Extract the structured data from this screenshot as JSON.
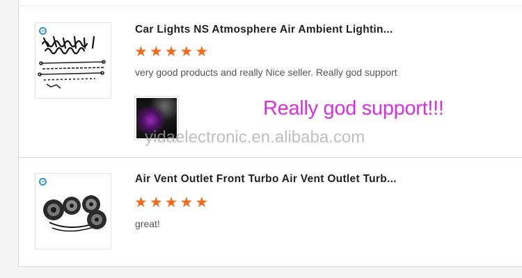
{
  "reviews": [
    {
      "title": "Car Lights NS Atmosphere Air Ambient Lightin...",
      "rating": 5,
      "stars": [
        "★",
        "★",
        "★",
        "★",
        "★"
      ],
      "comment": "very good products and really Nice seller. Really god support",
      "product_image_icon": "led-strip-kit-image",
      "photo_icon": "car-interior-ambient-light-photo"
    },
    {
      "title": "Air Vent Outlet Front Turbo Air Vent Outlet Turb...",
      "rating": 5,
      "stars": [
        "★",
        "★",
        "★",
        "★",
        "★"
      ],
      "comment": "great!",
      "product_image_icon": "turbo-air-vent-set-image"
    }
  ],
  "overlay": {
    "text": "Really god support!!!",
    "color": "#d62fe0"
  },
  "watermark": "yidaelectronic.en.alibaba.com",
  "colors": {
    "star": "#f26b1d",
    "title": "#1f1f1f",
    "comment": "#555555"
  }
}
